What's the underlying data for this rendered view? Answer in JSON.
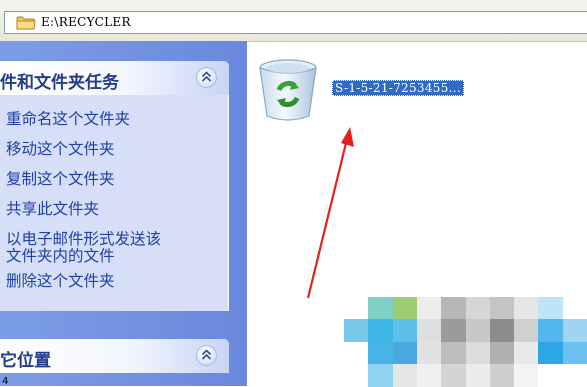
{
  "address_bar": {
    "path": "E:\\RECYCLER",
    "icon": "folder-icon"
  },
  "task_pane": {
    "file_folder_tasks": {
      "title": "件和文件夹任务",
      "collapse_icon": "chevron-up-icon",
      "tasks": [
        {
          "label": "重命名这个文件夹"
        },
        {
          "label": "移动这个文件夹"
        },
        {
          "label": "复制这个文件夹"
        },
        {
          "label": "共享此文件夹"
        },
        {
          "label_line1": "以电子邮件形式发送该",
          "label_line2": "文件夹内的文件"
        },
        {
          "label": "删除这个文件夹"
        }
      ]
    },
    "other_places": {
      "title": "它位置",
      "collapse_icon": "chevron-up-icon"
    }
  },
  "file_area": {
    "items": [
      {
        "icon": "recycle-bin-icon",
        "name": "S-1-5-21-7253455...",
        "selected": true
      }
    ],
    "annotation": {
      "type": "red-arrow",
      "color": "#e8201c"
    }
  },
  "colors": {
    "taskpane_bg": "#7c9de6",
    "panel_body_bg": "#d6dff7",
    "link_color": "#1f3fa6",
    "selection_bg": "#316ac5"
  },
  "page_fragment": "4"
}
